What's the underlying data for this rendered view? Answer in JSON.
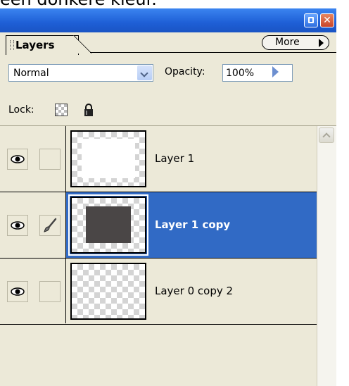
{
  "caption": "een donkere kleur.",
  "window": {
    "minimize_label": "",
    "close_label": "✕"
  },
  "panel": {
    "tab_label": "Layers",
    "more_label": "More"
  },
  "controls": {
    "blend_mode": "Normal",
    "opacity_label": "Opacity:",
    "opacity_value": "100%",
    "lock_label": "Lock:"
  },
  "layers": [
    {
      "name": "Layer 1",
      "visible": true,
      "selected": false,
      "brush": false,
      "thumb": "white"
    },
    {
      "name": "Layer 1 copy",
      "visible": true,
      "selected": true,
      "brush": true,
      "thumb": "dark"
    },
    {
      "name": "Layer 0 copy 2",
      "visible": true,
      "selected": false,
      "brush": false,
      "thumb": "transparent"
    }
  ],
  "colors": {
    "titlebar": "#1e5fd6",
    "panel_bg": "#ece9d8",
    "selection": "#316ac5",
    "dark_fill": "#4a4646"
  },
  "icons": {
    "visibility": "eye-icon",
    "paint": "brush-icon",
    "lock_transparency": "checkerboard-icon",
    "lock_all": "padlock-icon"
  }
}
